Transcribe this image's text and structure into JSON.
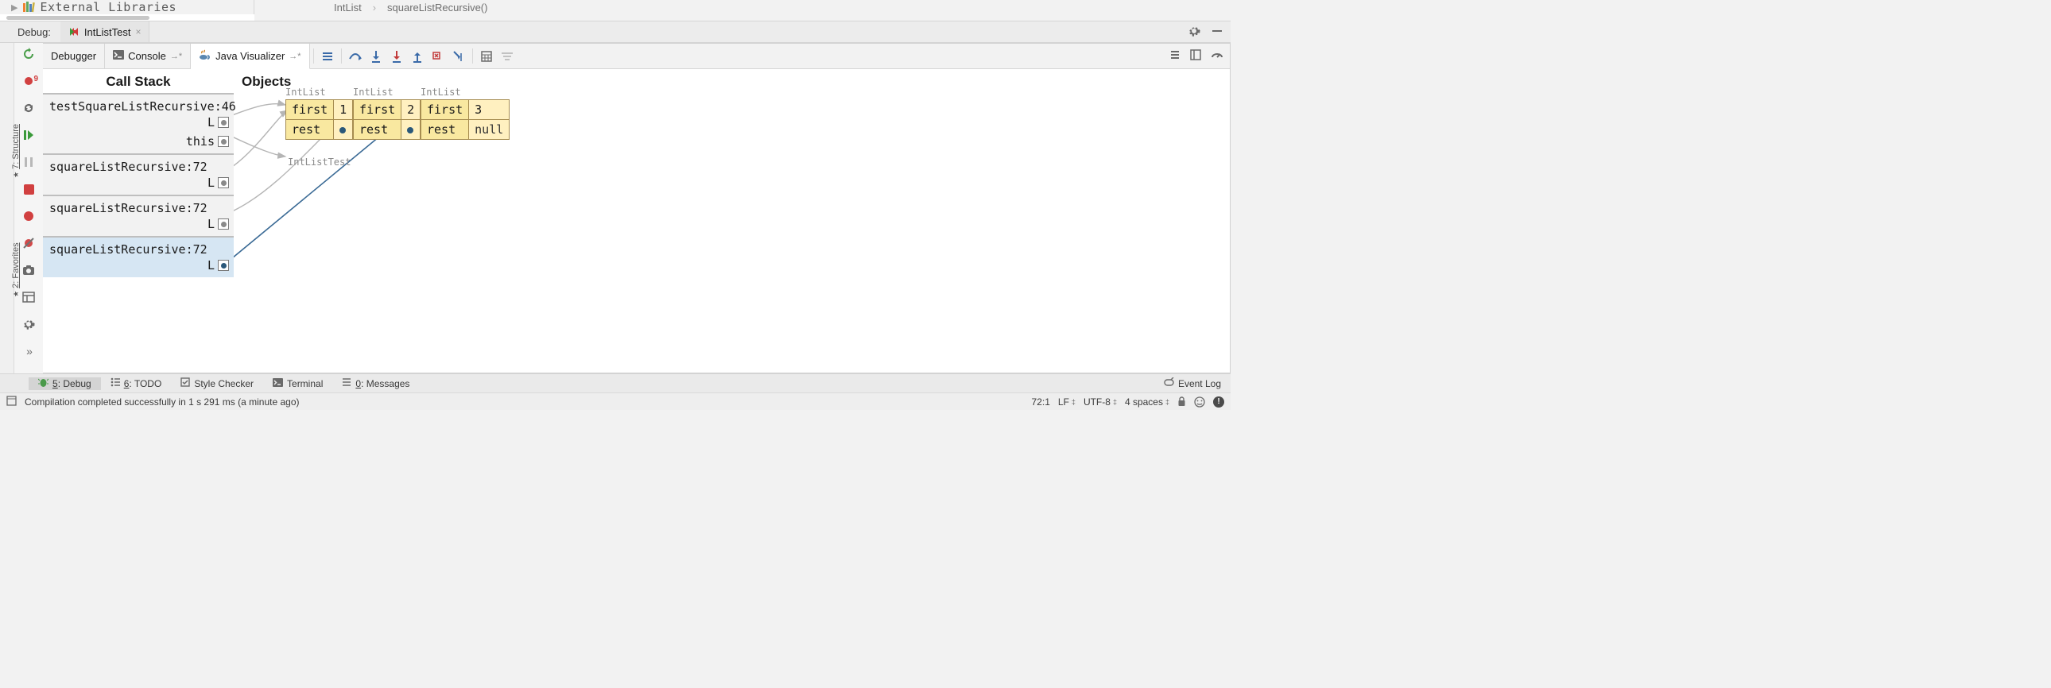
{
  "project": {
    "externalLib": "External Libraries"
  },
  "breadcrumb": {
    "cls": "IntList",
    "method": "squareListRecursive()"
  },
  "debugTab": {
    "caption": "Debug:",
    "tabName": "IntListTest"
  },
  "debuggerTabs": {
    "debugger": "Debugger",
    "console": "Console",
    "javaViz": "Java Visualizer"
  },
  "viz": {
    "callStackTitle": "Call Stack",
    "objectsTitle": "Objects",
    "frames": [
      {
        "name": "testSquareListRecursive:46",
        "vars": [
          "L",
          "this"
        ],
        "active": false
      },
      {
        "name": "squareListRecursive:72",
        "vars": [
          "L"
        ],
        "active": false
      },
      {
        "name": "squareListRecursive:72",
        "vars": [
          "L"
        ],
        "active": false
      },
      {
        "name": "squareListRecursive:72",
        "vars": [
          "L"
        ],
        "active": true
      }
    ],
    "objects": [
      {
        "type": "IntList",
        "first": "1",
        "rest": "ptr"
      },
      {
        "type": "IntList",
        "first": "2",
        "rest": "ptr"
      },
      {
        "type": "IntList",
        "first": "3",
        "rest": "null"
      }
    ],
    "testClassLabel": "IntListTest"
  },
  "sideLabels": {
    "structure": "7: Structure",
    "favorites": "2: Favorites"
  },
  "toolWindows": {
    "debug": "5: Debug",
    "todo": "6: TODO",
    "styleChecker": "Style Checker",
    "terminal": "Terminal",
    "messages": "0: Messages",
    "eventLog": "Event Log"
  },
  "status": {
    "message": "Compilation completed successfully in 1 s 291 ms (a minute ago)",
    "caret": "72:1",
    "lineEnd": "LF",
    "encoding": "UTF-8",
    "indent": "4 spaces"
  }
}
